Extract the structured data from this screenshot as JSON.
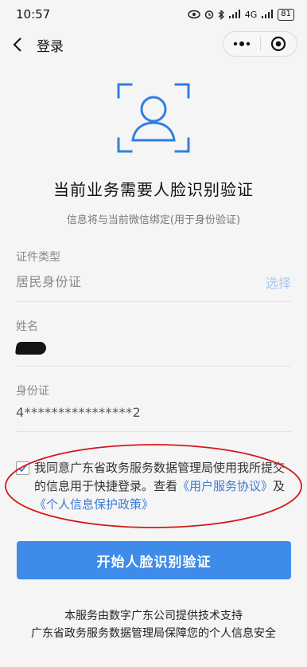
{
  "status_bar": {
    "time": "10:57",
    "signal_label": "4G",
    "battery": "81"
  },
  "nav": {
    "title": "登录",
    "more_icon": "more-dots-icon",
    "close_icon": "target-circle-icon"
  },
  "hero": {
    "icon": "face-scan-icon",
    "accent_color": "#2f7fe0",
    "title": "当前业务需要人脸识别验证",
    "subtitle": "信息将与当前微信绑定(用于身份验证)"
  },
  "form": {
    "id_type": {
      "label": "证件类型",
      "value": "居民身份证",
      "action": "选择"
    },
    "name": {
      "label": "姓名"
    },
    "id_number": {
      "label": "身份证",
      "value": "4****************2"
    }
  },
  "agreement": {
    "checked": true,
    "text_before": "我同意广东省政务服务数据管理局使用我所提交的信息用于快捷登录。查看",
    "link_user_agreement": "《用户服务协议》",
    "text_and": "及",
    "link_privacy": "《个人信息保护政策》"
  },
  "button": {
    "label": "开始人脸识别验证",
    "color": "#3e8bea"
  },
  "footer": {
    "line1": "本服务由数字广东公司提供技术支持",
    "line2": "广东省政务服务数据管理局保障您的个人信息安全"
  }
}
